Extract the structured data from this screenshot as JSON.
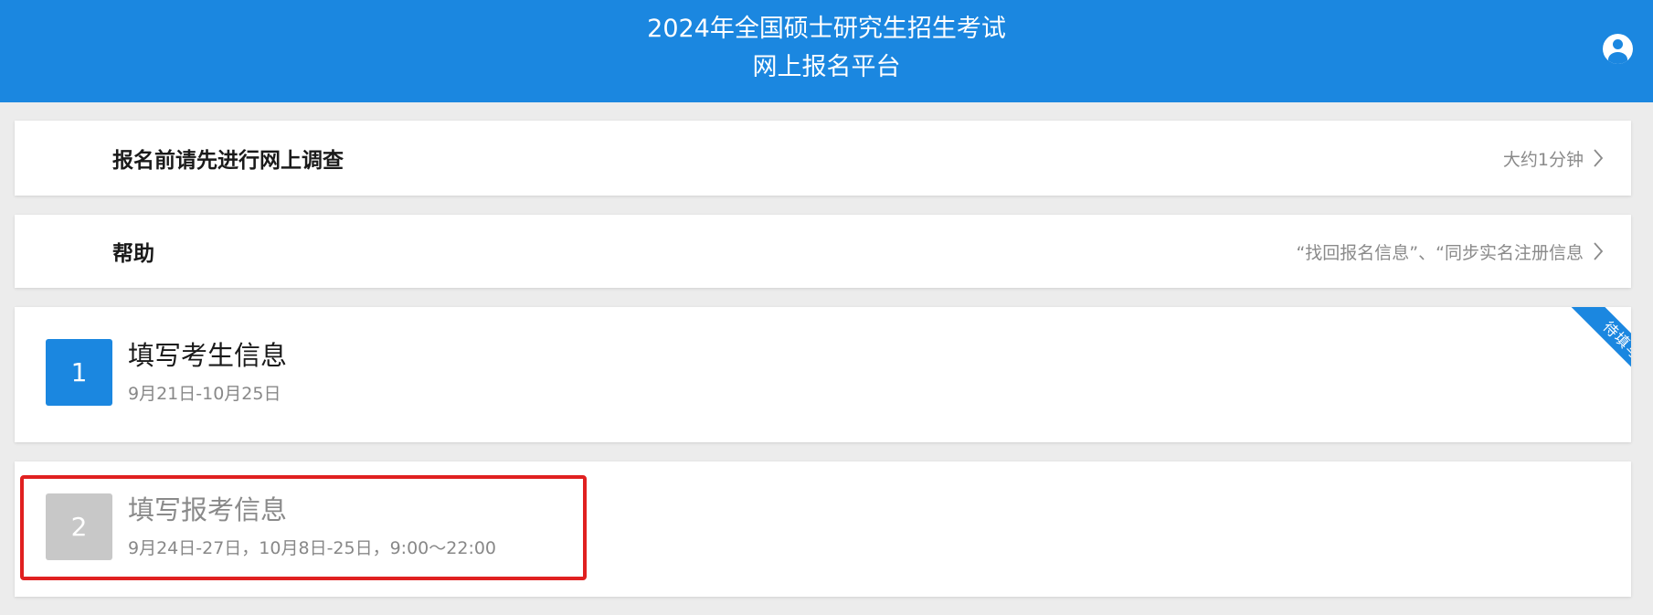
{
  "header": {
    "title_line1": "2024年全国硕士研究生招生考试",
    "title_line2": "网上报名平台",
    "user_icon": "user-icon"
  },
  "survey": {
    "label": "报名前请先进行网上调查",
    "hint": "大约1分钟"
  },
  "help": {
    "label": "帮助",
    "hint": "“找回报名信息”、“同步实名注册信息"
  },
  "steps": [
    {
      "number": "1",
      "title": "填写考生信息",
      "date": "9月21日-10月25日",
      "badge": "待填写",
      "color": "#1b87e0"
    },
    {
      "number": "2",
      "title": "填写报考信息",
      "date": "9月24日-27日，10月8日-25日，9:00～22:00",
      "color": "#c8c8c8"
    }
  ],
  "colors": {
    "brand": "#1b87e0",
    "highlight": "#e02020"
  }
}
